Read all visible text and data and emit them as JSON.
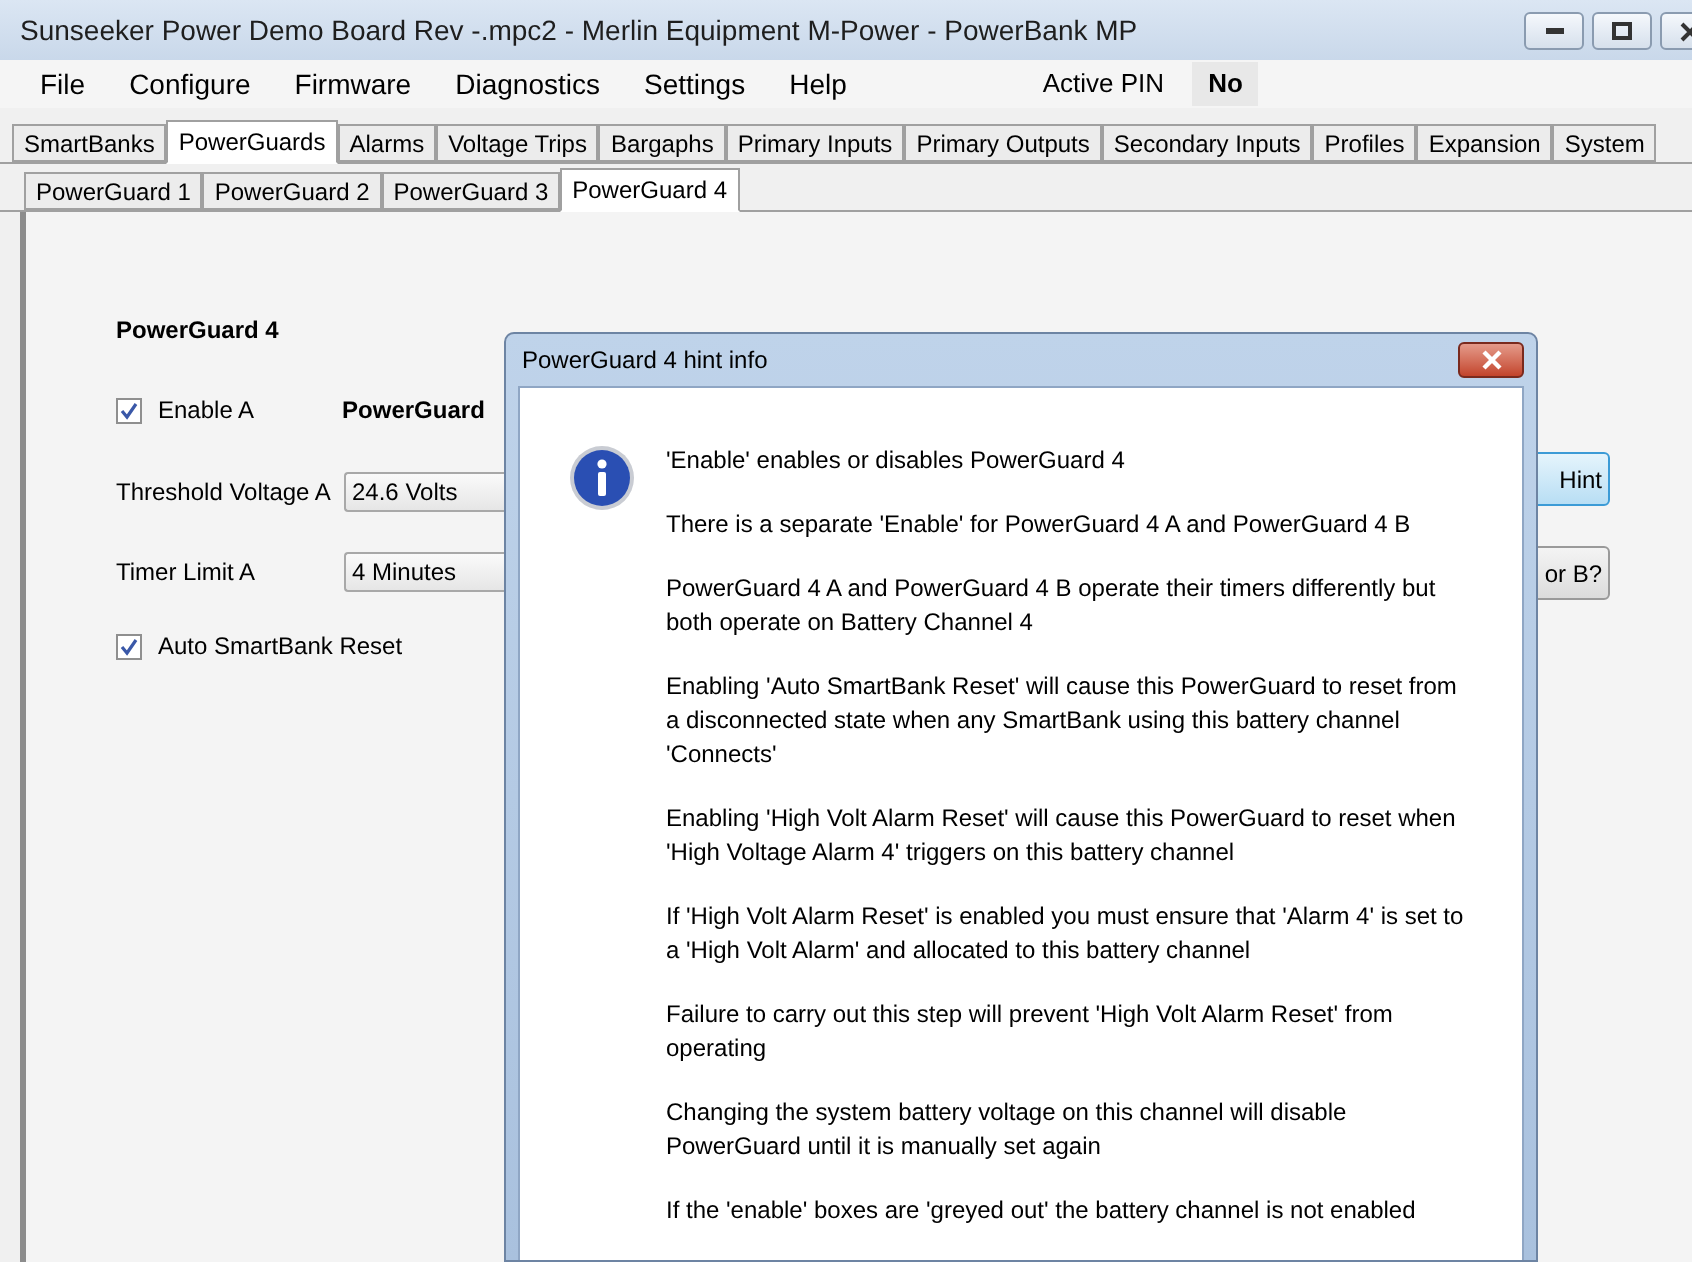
{
  "window": {
    "title": "Sunseeker Power Demo Board Rev -.mpc2 - Merlin Equipment M-Power - PowerBank MP"
  },
  "menu": [
    {
      "label": "File"
    },
    {
      "label": "Configure"
    },
    {
      "label": "Firmware"
    },
    {
      "label": "Diagnostics"
    },
    {
      "label": "Settings"
    },
    {
      "label": "Help"
    }
  ],
  "active_pin": {
    "label": "Active PIN",
    "value": "No"
  },
  "tabs": [
    {
      "label": "SmartBanks",
      "selected": false
    },
    {
      "label": "PowerGuards",
      "selected": true
    },
    {
      "label": "Alarms",
      "selected": false
    },
    {
      "label": "Voltage Trips",
      "selected": false
    },
    {
      "label": "Bargaphs",
      "selected": false
    },
    {
      "label": "Primary Inputs",
      "selected": false
    },
    {
      "label": "Primary Outputs",
      "selected": false
    },
    {
      "label": "Secondary Inputs",
      "selected": false
    },
    {
      "label": "Profiles",
      "selected": false
    },
    {
      "label": "Expansion",
      "selected": false
    },
    {
      "label": "System",
      "selected": false
    }
  ],
  "subtabs": [
    {
      "label": "PowerGuard 1",
      "selected": false
    },
    {
      "label": "PowerGuard 2",
      "selected": false
    },
    {
      "label": "PowerGuard 3",
      "selected": false
    },
    {
      "label": "PowerGuard 4",
      "selected": true
    }
  ],
  "panel": {
    "heading": "PowerGuard 4",
    "enable_a": {
      "label": "Enable A",
      "checked": true
    },
    "section_label": "PowerGuard",
    "threshold": {
      "label": "Threshold Voltage A",
      "value": "24.6 Volts"
    },
    "timer": {
      "label": "Timer Limit A",
      "value": "4 Minutes"
    },
    "auto_reset": {
      "label": "Auto SmartBank Reset",
      "checked": true
    },
    "buttons": [
      {
        "label": "Hint",
        "focused": true
      },
      {
        "label": "or B?",
        "focused": false
      }
    ]
  },
  "dialog": {
    "title": "PowerGuard 4 hint info",
    "paragraphs": [
      "'Enable' enables or disables PowerGuard 4",
      "There is a separate 'Enable' for PowerGuard 4 A and PowerGuard 4 B",
      "PowerGuard 4 A and PowerGuard 4 B operate their timers differently but both operate on Battery Channel 4",
      "Enabling 'Auto SmartBank Reset' will cause this PowerGuard to reset from a disconnected state when any SmartBank using this battery channel 'Connects'",
      "Enabling 'High Volt Alarm Reset' will cause this PowerGuard to reset when 'High Voltage Alarm 4' triggers on this battery channel",
      "If 'High Volt Alarm Reset' is enabled you must ensure that 'Alarm 4' is set to a 'High Volt Alarm' and allocated to this battery channel",
      "Failure to carry out this step will prevent 'High Volt Alarm Reset' from operating",
      "Changing the system battery voltage on this channel will disable PowerGuard until it is manually set again",
      "If the 'enable' boxes are 'greyed out' the battery channel is not enabled"
    ]
  }
}
